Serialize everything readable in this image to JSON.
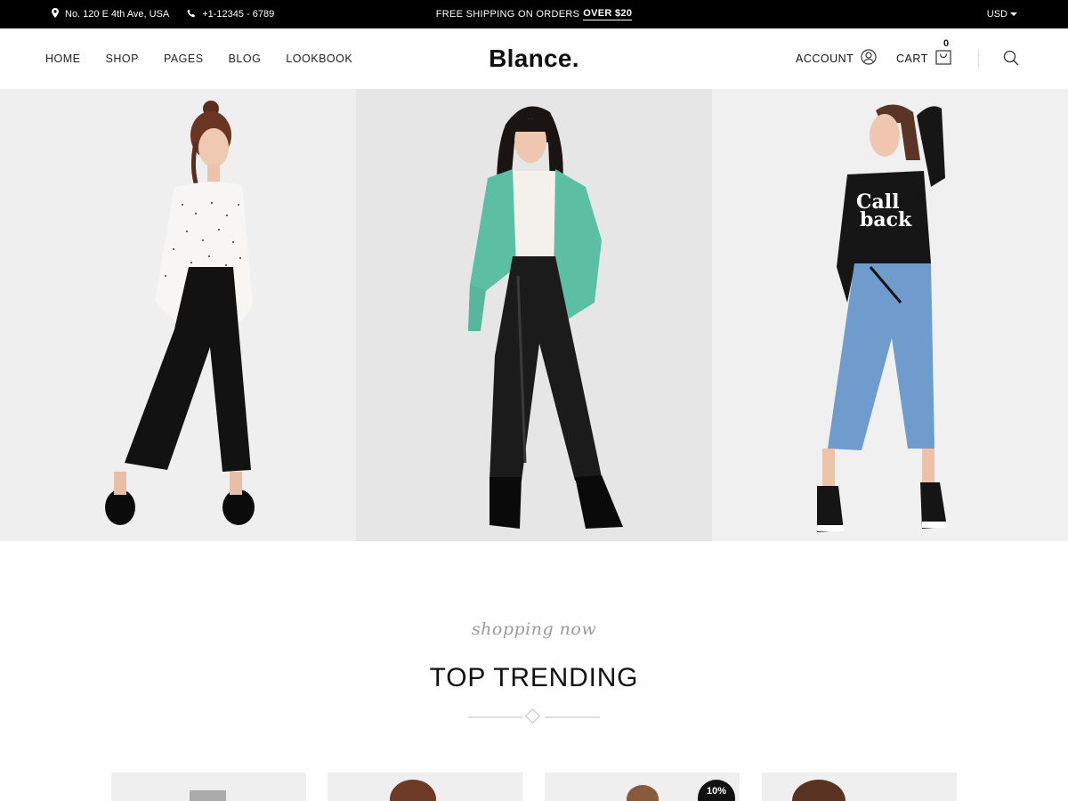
{
  "topbar": {
    "address": "No. 120 E 4th Ave, USA",
    "phone": "+1-12345 - 6789",
    "shipping_prefix": "FREE SHIPPING ON ORDERS",
    "shipping_highlight": "OVER $20",
    "currency": "USD"
  },
  "nav": {
    "items": [
      "HOME",
      "SHOP",
      "PAGES",
      "BLOG",
      "LOOKBOOK"
    ]
  },
  "brand": {
    "logo": "Blance."
  },
  "header_actions": {
    "account_label": "ACCOUNT",
    "cart_label": "CART",
    "cart_count": "0"
  },
  "hero": {
    "shirt_text_line1": "Call",
    "shirt_text_line2": "back"
  },
  "section": {
    "script_text": "shopping now",
    "title": "TOP TRENDING"
  },
  "products": {
    "badge": "10%"
  },
  "colors": {
    "topbar_bg": "#000000",
    "accent_jacket": "#5cbfa4",
    "panel_bg_1": "#efeff0",
    "panel_bg_2": "#e7e6e7",
    "panel_bg_3": "#f0f0f1"
  }
}
